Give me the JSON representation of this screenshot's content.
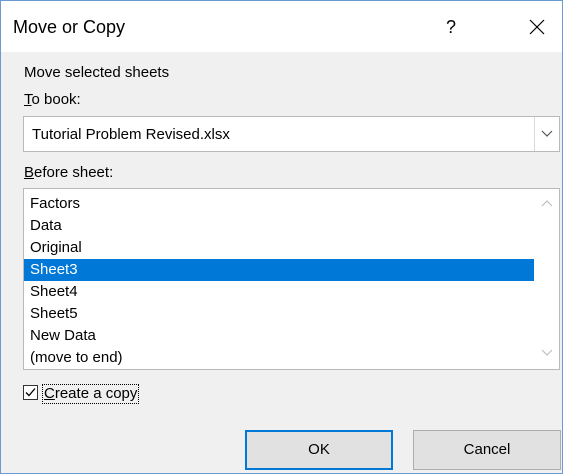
{
  "dialog": {
    "title": "Move or Copy",
    "help_label": "?",
    "instruction": "Move selected sheets",
    "to_book_label": "To book:",
    "to_book_value": "Tutorial Problem Revised.xlsx",
    "before_sheet_label": "Before sheet:",
    "sheets": [
      {
        "label": "Factors",
        "selected": false
      },
      {
        "label": "Data",
        "selected": false
      },
      {
        "label": "Original",
        "selected": false
      },
      {
        "label": "Sheet3",
        "selected": true
      },
      {
        "label": "Sheet4",
        "selected": false
      },
      {
        "label": "Sheet5",
        "selected": false
      },
      {
        "label": "New Data",
        "selected": false
      },
      {
        "label": "(move to end)",
        "selected": false
      }
    ],
    "create_copy_label": "Create a copy",
    "create_copy_checked": true,
    "ok_label": "OK",
    "cancel_label": "Cancel"
  },
  "icons": {
    "help": "question-mark-icon",
    "close": "close-icon",
    "dropdown": "chevron-down-icon",
    "scroll_up": "chevron-up-icon",
    "scroll_down": "chevron-down-icon",
    "check": "checkmark-icon"
  },
  "colors": {
    "selection": "#0078d7",
    "default_button_border": "#0078d7",
    "dialog_background": "#f0f0f0"
  }
}
